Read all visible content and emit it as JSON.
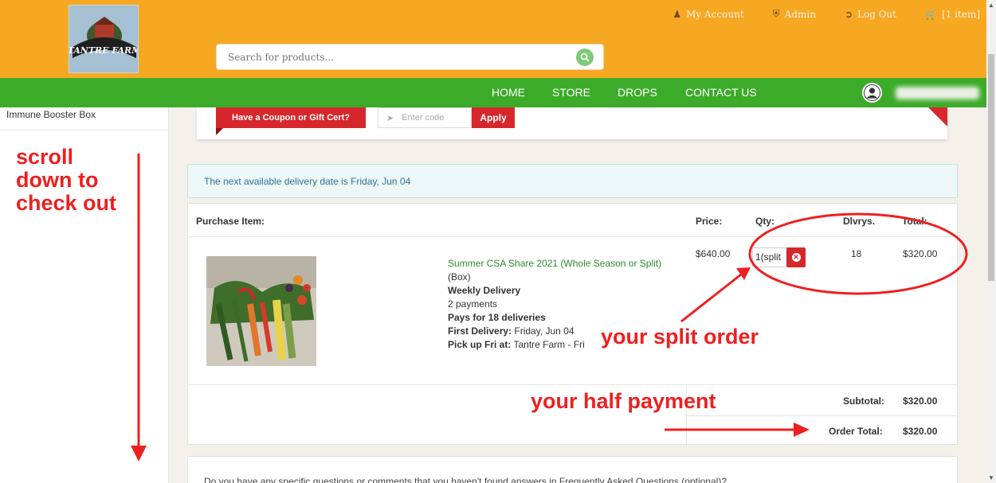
{
  "header": {
    "logo_text": "TANTRE FARM",
    "links": [
      {
        "icon": "user-icon",
        "label": "My Account"
      },
      {
        "icon": "shield-icon",
        "label": "Admin"
      },
      {
        "icon": "logout-icon",
        "label": "Log Out"
      },
      {
        "icon": "cart-icon",
        "label": "[1 item]"
      }
    ],
    "search_placeholder": "Search for products..."
  },
  "nav": {
    "items": [
      "HOME",
      "STORE",
      "DROPS",
      "CONTACT US"
    ]
  },
  "sidebar": {
    "items": [
      "Immune Booster Box"
    ]
  },
  "coupon": {
    "label": "Have a Coupon or Gift Cert?",
    "placeholder": "Enter code",
    "apply_label": "Apply"
  },
  "delivery_notice": "The next available delivery date is Friday, Jun 04",
  "cart": {
    "headers": {
      "item": "Purchase Item:",
      "price": "Price:",
      "qty": "Qty:",
      "deliveries": "Dlvrys.",
      "total": "Total:"
    },
    "item": {
      "name": "Summer CSA Share 2021 (Whole Season or Split)",
      "type": "(Box)",
      "schedule": "Weekly Delivery",
      "payments": "2 payments",
      "pays_for": "Pays for 18 deliveries",
      "first_delivery_label": "First Delivery:",
      "first_delivery_value": "Friday, Jun 04",
      "pickup_label": "Pick up Fri at:",
      "pickup_value": "Tantre Farm - Fri",
      "price": "$640.00",
      "qty": "1(split",
      "deliveries": "18",
      "total": "$320.00"
    },
    "subtotal_label": "Subtotal:",
    "subtotal": "$320.00",
    "order_total_label": "Order Total:",
    "order_total": "$320.00"
  },
  "faq_prompt": "Do you have any specific questions or comments that you haven't found answers in Frequently Asked Questions (optional)?",
  "annotations": {
    "scroll": "scroll down to check out",
    "split": "your split order",
    "half": "your half payment"
  },
  "colors": {
    "header": "#f7a823",
    "nav": "#3dab2a",
    "accent_red": "#d6282c",
    "annotation": "#ee2020"
  }
}
